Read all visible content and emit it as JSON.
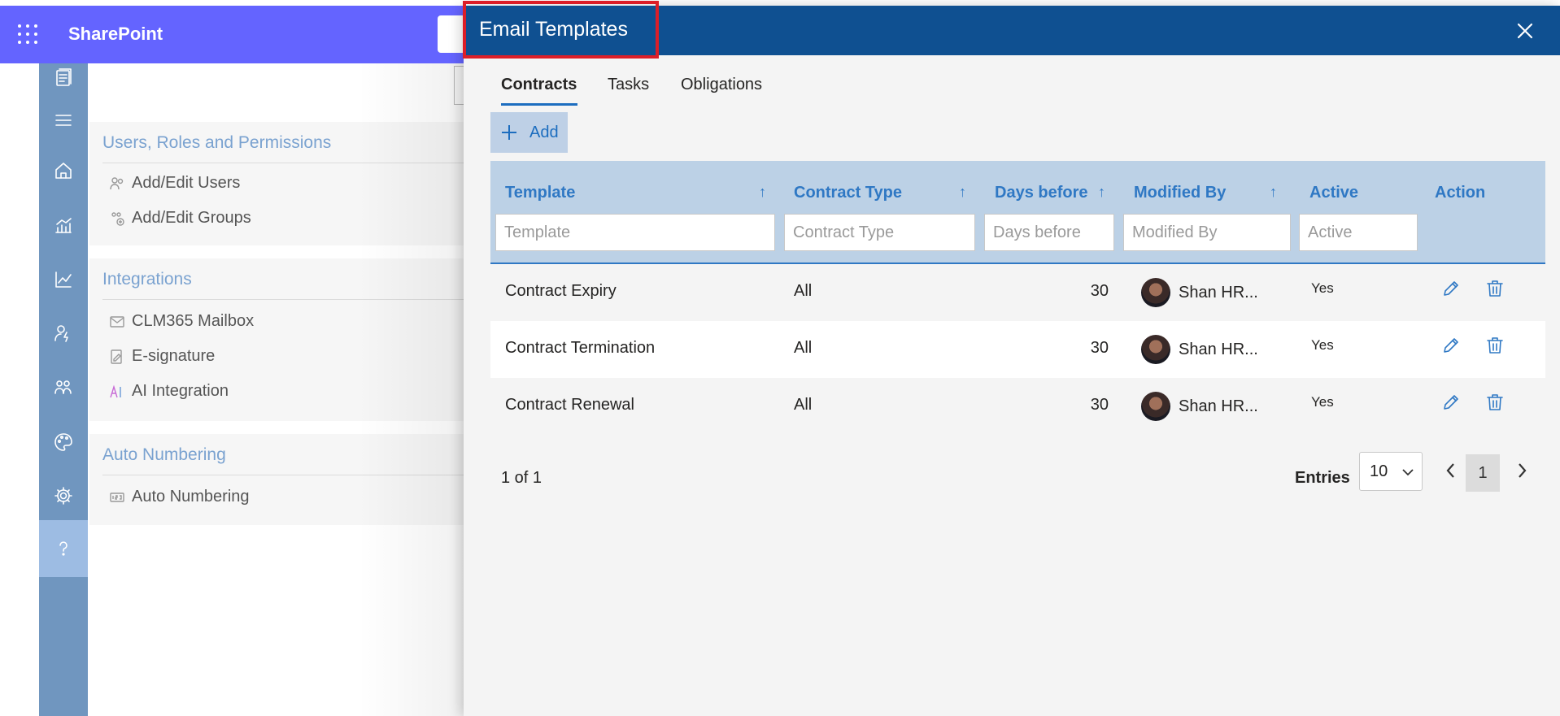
{
  "suite_bar": {
    "app_title": "SharePoint"
  },
  "settings_panel": {
    "sections": [
      {
        "title": "Users, Roles and Permissions",
        "items": [
          "Add/Edit Users",
          "Add/Edit Groups"
        ]
      },
      {
        "title": "Integrations",
        "items": [
          "CLM365 Mailbox",
          "E-signature",
          "AI Integration"
        ]
      },
      {
        "title": "Auto Numbering",
        "items": [
          "Auto Numbering"
        ]
      }
    ]
  },
  "dialog": {
    "title": "Email Templates",
    "tabs": [
      "Contracts",
      "Tasks",
      "Obligations"
    ],
    "active_tab": "Contracts",
    "add_label": "Add",
    "table": {
      "headers": {
        "template": "Template",
        "contract_type": "Contract Type",
        "days_before": "Days before",
        "modified_by": "Modified By",
        "active": "Active",
        "action": "Action"
      },
      "filters": {
        "template": "Template",
        "contract_type": "Contract Type",
        "days_before": "Days before",
        "modified_by": "Modified By",
        "active": "Active"
      },
      "rows": [
        {
          "template": "Contract Expiry",
          "contract_type": "All",
          "days_before": "30",
          "modified_by": "Shan HR...",
          "active": "Yes"
        },
        {
          "template": "Contract Termination",
          "contract_type": "All",
          "days_before": "30",
          "modified_by": "Shan HR...",
          "active": "Yes"
        },
        {
          "template": "Contract Renewal",
          "contract_type": "All",
          "days_before": "30",
          "modified_by": "Shan HR...",
          "active": "Yes"
        }
      ]
    },
    "pagination": {
      "summary": "1 of 1",
      "entries_label": "Entries",
      "entries_value": "10",
      "current_page": "1"
    }
  },
  "colors": {
    "suite_bar": "#6464ff",
    "nav_rail": "#7096bf",
    "dialog_header": "#0f5091",
    "accent": "#2f78c4",
    "highlight_box": "#dc1e28"
  }
}
